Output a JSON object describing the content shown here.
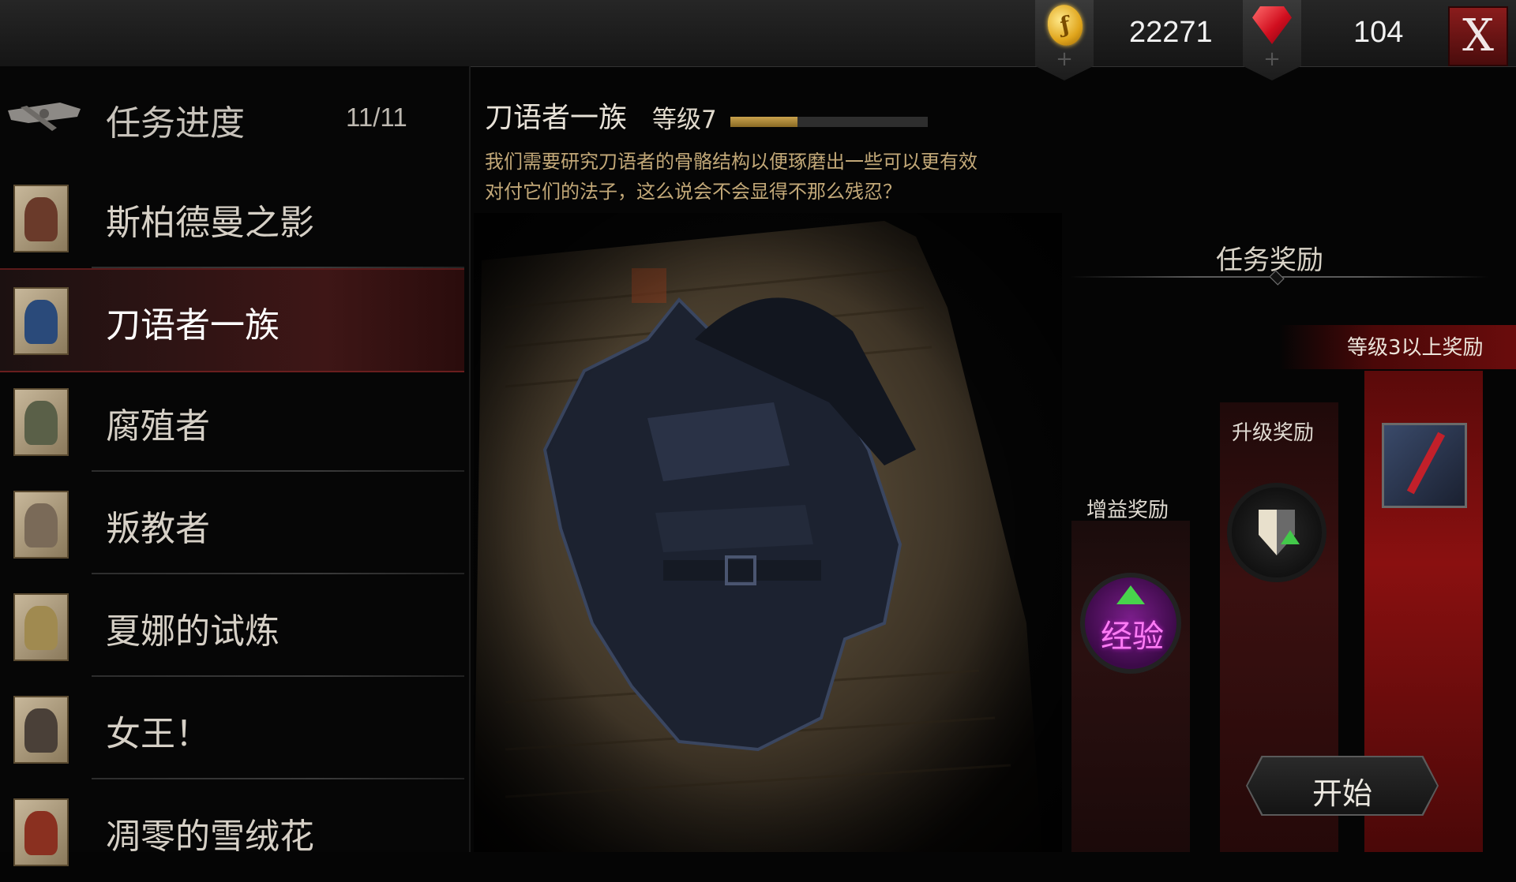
{
  "currency": {
    "gold": {
      "icon": "gold-coin-icon",
      "value": "22271"
    },
    "gems": {
      "icon": "ruby-gem-icon",
      "value": "104"
    },
    "add_symbol": "+"
  },
  "close_label": "X",
  "sidebar": {
    "progress_label": "任务进度",
    "progress_count": "11/11",
    "items": [
      {
        "label": "斯柏德曼之影"
      },
      {
        "label": "刀语者一族"
      },
      {
        "label": "腐殖者"
      },
      {
        "label": "叛教者"
      },
      {
        "label": "夏娜的试炼"
      },
      {
        "label": "女王！"
      },
      {
        "label": "凋零的雪绒花"
      }
    ],
    "selected_index": 1
  },
  "detail": {
    "title": "刀语者一族",
    "level": "等级7",
    "progress": 0.34,
    "description": "我们需要研究刀语者的骨骼结构以便琢磨出一些可以更有效对付它们的法子，这么说会不会显得不那么残忍？"
  },
  "rewards": {
    "title": "任务奖励",
    "bonus_label": "增益奖励",
    "bonus_orb_text": "经验",
    "upgrade_label": "升级奖励",
    "tier_label": "等级3以上奖励"
  },
  "start_label": "开始",
  "colors": {
    "accent_red": "#8a1010",
    "xp_fill": "#c9a24d",
    "desc_text": "#c2a878"
  }
}
